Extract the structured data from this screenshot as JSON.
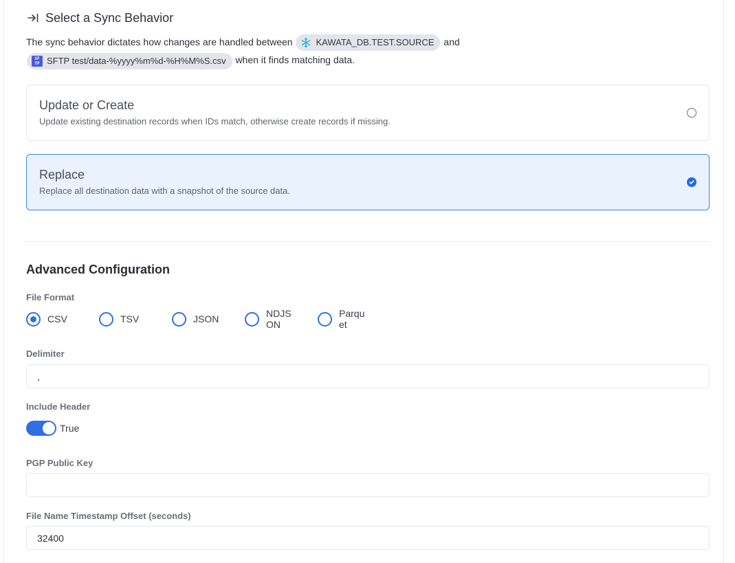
{
  "header": {
    "title": "Select a Sync Behavior"
  },
  "intro": {
    "text_before": "The sync behavior dictates how changes are handled between",
    "source_chip": "KAWATA_DB.TEST.SOURCE",
    "text_middle": "and",
    "destination_chip": "SFTP test/data-%yyyy%m%d-%H%M%S.csv",
    "sftp_icon_text_top": "SF",
    "sftp_icon_text_bottom": "TP",
    "text_after": "when it finds matching data."
  },
  "sync_options": [
    {
      "title": "Update or Create",
      "description": "Update existing destination records when IDs match, otherwise create records if missing.",
      "selected": false
    },
    {
      "title": "Replace",
      "description": "Replace all destination data with a snapshot of the source data.",
      "selected": true
    }
  ],
  "advanced": {
    "title": "Advanced Configuration",
    "file_format": {
      "label": "File Format",
      "options": [
        "CSV",
        "TSV",
        "JSON",
        "NDJSON",
        "Parquet"
      ],
      "selected": "CSV"
    },
    "delimiter": {
      "label": "Delimiter",
      "value": ","
    },
    "include_header": {
      "label": "Include Header",
      "value": true,
      "value_label": "True"
    },
    "pgp_public_key": {
      "label": "PGP Public Key",
      "value": ""
    },
    "timestamp_offset": {
      "label": "File Name Timestamp Offset (seconds)",
      "value": "32400"
    }
  },
  "colors": {
    "accent": "#2f6fe4",
    "selected_card_bg": "#eaf2fe",
    "chip_bg": "#e4e5ea",
    "snowflake": "#29b5e8",
    "sftp_icon_bg": "#4b5ad6"
  },
  "icons": {
    "title_icon": "arrow-right-to-bracket-icon",
    "source_icon": "snowflake-icon",
    "destination_icon": "sftp-icon"
  }
}
